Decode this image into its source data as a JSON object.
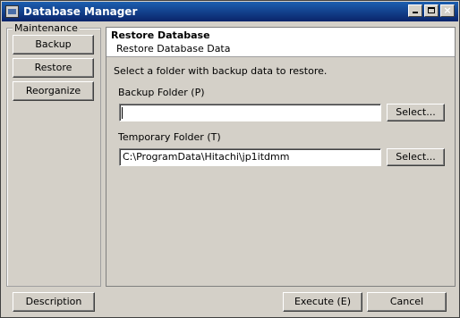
{
  "window": {
    "title": "Database Manager"
  },
  "sidebar": {
    "group_label": "Maintenance",
    "buttons": [
      "Backup",
      "Restore",
      "Reorganize"
    ]
  },
  "panel": {
    "title": "Restore Database",
    "subtitle": "Restore Database Data",
    "instruction": "Select a folder with backup data to restore.",
    "backup_folder": {
      "label": "Backup Folder (P)",
      "value": "",
      "select_label": "Select..."
    },
    "temporary_folder": {
      "label": "Temporary Folder (T)",
      "value": "C:\\ProgramData\\Hitachi\\jp1itdmm",
      "select_label": "Select..."
    }
  },
  "footer": {
    "description_label": "Description",
    "execute_label": "Execute (E)",
    "cancel_label": "Cancel"
  },
  "icons": [
    "app-icon",
    "minimize-icon",
    "maximize-icon",
    "close-icon"
  ],
  "colors": {
    "titlebar": "#0a246a",
    "face": "#d4d0c8"
  }
}
